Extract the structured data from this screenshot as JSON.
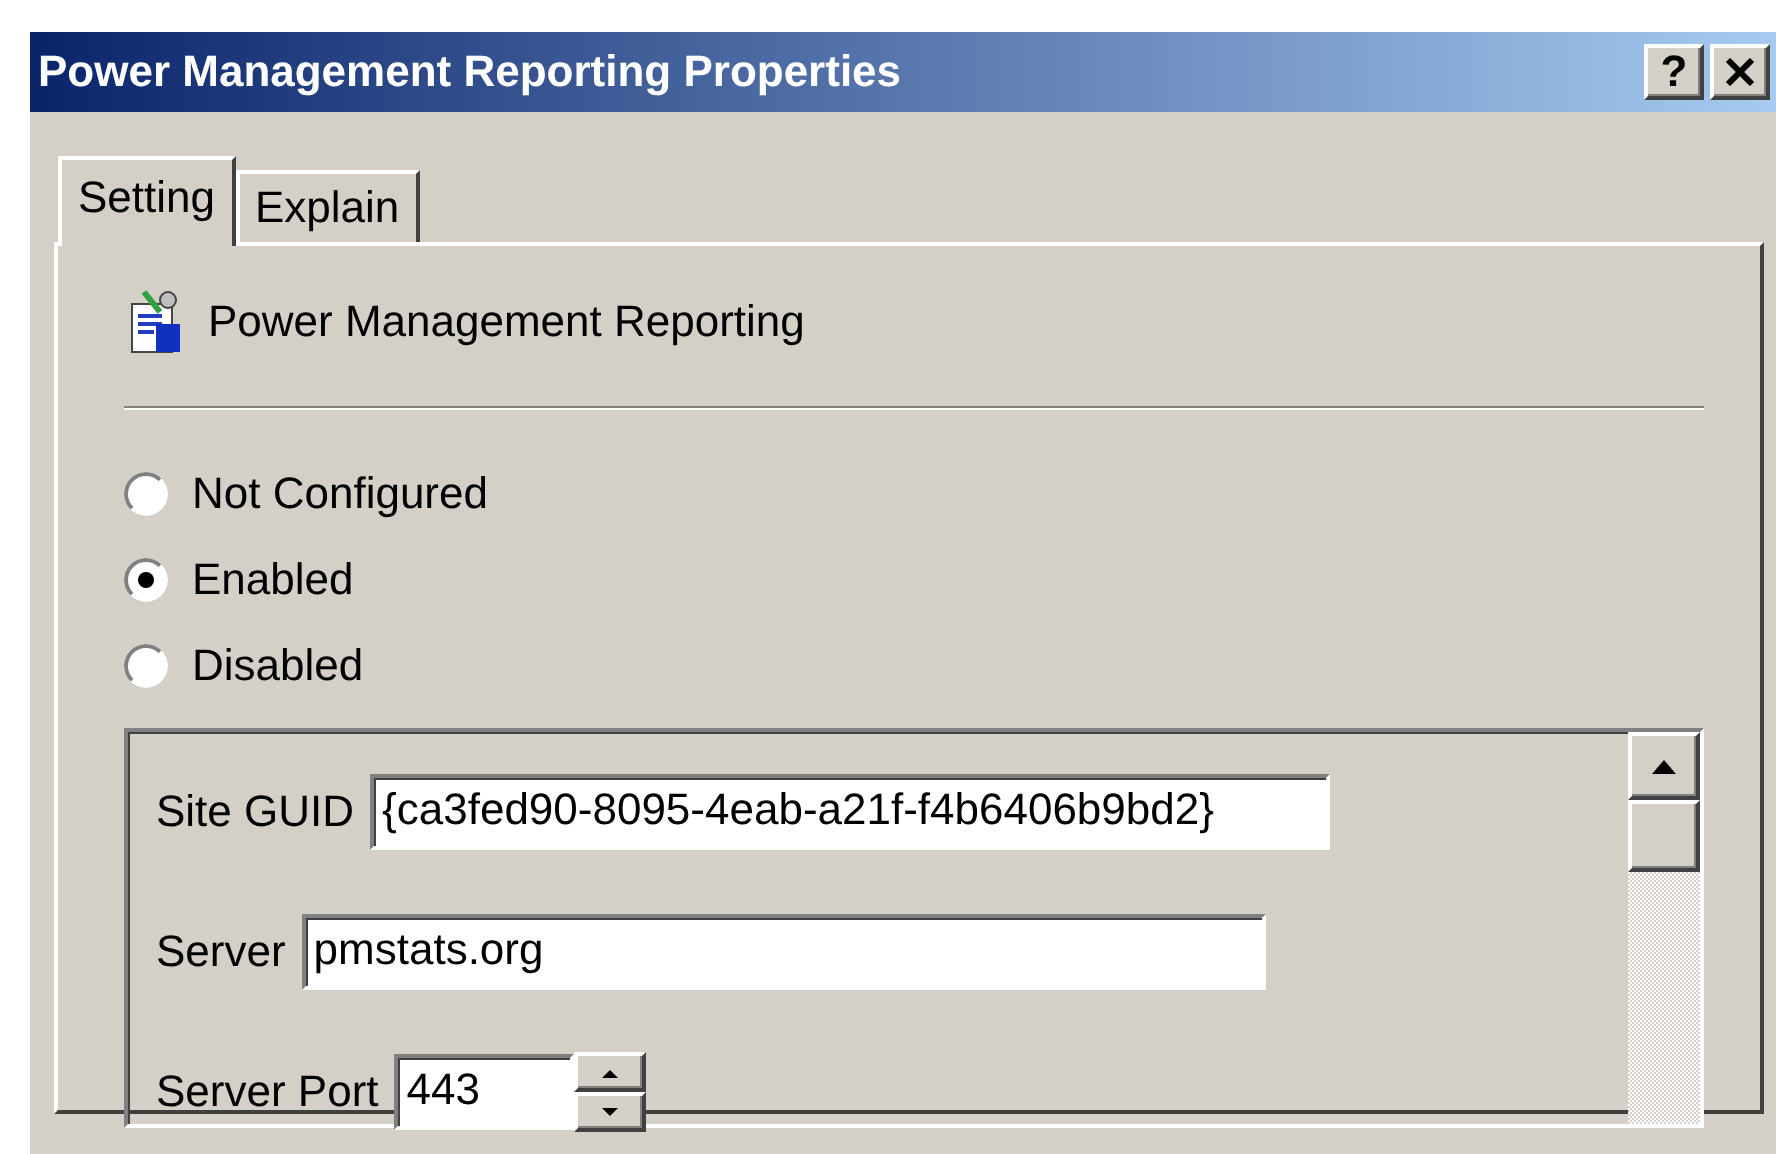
{
  "window": {
    "title": "Power Management Reporting Properties",
    "help_button": "?"
  },
  "tabs": [
    {
      "label": "Setting",
      "selected": true
    },
    {
      "label": "Explain",
      "selected": false
    }
  ],
  "policy": {
    "name": "Power Management Reporting"
  },
  "options": [
    {
      "label": "Not Configured",
      "selected": false
    },
    {
      "label": "Enabled",
      "selected": true
    },
    {
      "label": "Disabled",
      "selected": false
    }
  ],
  "fields": [
    {
      "kind": "text",
      "label": "Site GUID",
      "value": "{ca3fed90-8095-4eab-a21f-f4b6406b9bd2}"
    },
    {
      "kind": "text",
      "label": "Server",
      "value": "pmstats.org"
    },
    {
      "kind": "spin",
      "label": "Server Port",
      "value": "443"
    }
  ]
}
